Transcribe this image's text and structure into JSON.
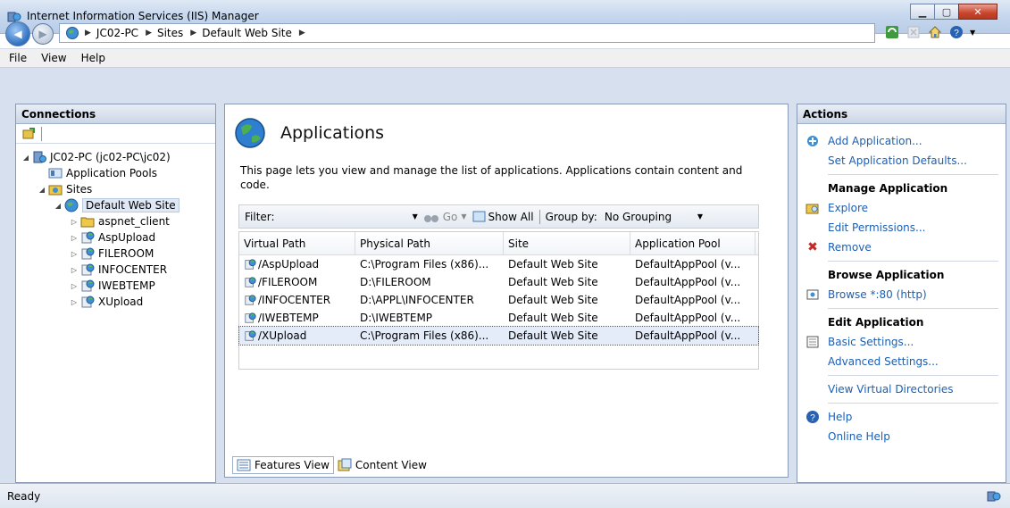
{
  "window": {
    "title": "Internet Information Services (IIS) Manager",
    "min": "▁",
    "max": "▢",
    "close": "✕"
  },
  "address": {
    "crumbs": [
      "JC02-PC",
      "Sites",
      "Default Web Site"
    ]
  },
  "menu": {
    "items": [
      "File",
      "View",
      "Help"
    ]
  },
  "connections": {
    "header": "Connections",
    "tree": [
      {
        "label": "JC02-PC (jc02-PC\\jc02)",
        "indent": 0,
        "expander": "◢",
        "icon": "server-icon"
      },
      {
        "label": "Application Pools",
        "indent": 1,
        "expander": "",
        "icon": "app-pools-icon"
      },
      {
        "label": "Sites",
        "indent": 1,
        "expander": "◢",
        "icon": "sites-folder-icon"
      },
      {
        "label": "Default Web Site",
        "indent": 2,
        "expander": "◢",
        "icon": "website-globe-icon",
        "selected": true
      },
      {
        "label": "aspnet_client",
        "indent": 3,
        "expander": "▷",
        "icon": "folder-icon"
      },
      {
        "label": "AspUpload",
        "indent": 3,
        "expander": "▷",
        "icon": "application-icon"
      },
      {
        "label": "FILEROOM",
        "indent": 3,
        "expander": "▷",
        "icon": "application-icon"
      },
      {
        "label": "INFOCENTER",
        "indent": 3,
        "expander": "▷",
        "icon": "application-icon"
      },
      {
        "label": "IWEBTEMP",
        "indent": 3,
        "expander": "▷",
        "icon": "application-icon"
      },
      {
        "label": "XUpload",
        "indent": 3,
        "expander": "▷",
        "icon": "application-icon"
      }
    ]
  },
  "main": {
    "title": "Applications",
    "description": "This page lets you view and manage the list of applications. Applications contain content and code.",
    "filter": {
      "label": "Filter:",
      "go": "Go",
      "show_all": "Show All",
      "group_by_label": "Group by:",
      "group_by_value": "No Grouping"
    },
    "columns": [
      "Virtual Path",
      "Physical Path",
      "Site",
      "Application Pool"
    ],
    "rows": [
      [
        "/AspUpload",
        "C:\\Program Files (x86)...",
        "Default Web Site",
        "DefaultAppPool (v..."
      ],
      [
        "/FILEROOM",
        "D:\\FILEROOM",
        "Default Web Site",
        "DefaultAppPool (v..."
      ],
      [
        "/INFOCENTER",
        "D:\\APPL\\INFOCENTER",
        "Default Web Site",
        "DefaultAppPool (v..."
      ],
      [
        "/IWEBTEMP",
        "D:\\IWEBTEMP",
        "Default Web Site",
        "DefaultAppPool (v..."
      ],
      [
        "/XUpload",
        "C:\\Program Files (x86)...",
        "Default Web Site",
        "DefaultAppPool (v..."
      ]
    ],
    "selected_row": 4,
    "tabs": {
      "features": "Features View",
      "content": "Content View"
    }
  },
  "actions": {
    "header": "Actions",
    "add_application": "Add Application...",
    "set_defaults": "Set Application Defaults...",
    "manage_group": "Manage Application",
    "explore": "Explore",
    "edit_permissions": "Edit Permissions...",
    "remove": "Remove",
    "browse_group": "Browse Application",
    "browse": "Browse *:80 (http)",
    "edit_group": "Edit Application",
    "basic_settings": "Basic Settings...",
    "advanced_settings": "Advanced Settings...",
    "view_vdirs": "View Virtual Directories",
    "help": "Help",
    "online_help": "Online Help"
  },
  "status": {
    "text": "Ready"
  },
  "colors": {
    "link": "#1c5fb4",
    "remove_x": "#c62828"
  }
}
